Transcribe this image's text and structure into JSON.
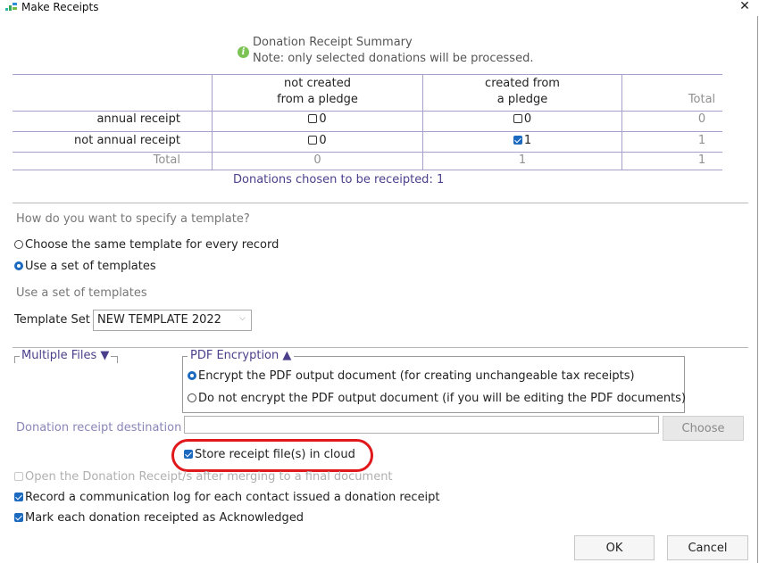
{
  "window": {
    "title": "Make Receipts",
    "close_glyph": "✕"
  },
  "summary": {
    "heading": "Donation Receipt Summary",
    "note": "Note: only selected donations will be processed.",
    "info_icon_glyph": "i"
  },
  "table": {
    "col1_line1": "not created",
    "col1_line2": "from a pledge",
    "col2_line1": "created from",
    "col2_line2": "a pledge",
    "col3": "Total",
    "rows": [
      {
        "label": "annual receipt",
        "c1": "0",
        "c1_checked": false,
        "c2": "0",
        "c2_checked": false,
        "total": "0"
      },
      {
        "label": "not annual receipt",
        "c1": "0",
        "c1_checked": false,
        "c2": "1",
        "c2_checked": true,
        "total": "1"
      }
    ],
    "total_row": {
      "label": "Total",
      "c1": "0",
      "c2": "1",
      "total": "1"
    },
    "chosen_text": "Donations chosen to be receipted: 1"
  },
  "template": {
    "question": "How do you want to specify a template?",
    "option_same": "Choose the same template for every record",
    "option_set": "Use a set of templates",
    "selected": "set",
    "subheading": "Use a set of templates",
    "set_label": "Template Set",
    "set_value": "NEW TEMPLATE 2022"
  },
  "multiple_files": {
    "label": "Multiple Files ▼"
  },
  "pdf": {
    "label": "PDF Encryption ▲",
    "encrypt": "Encrypt the PDF output document (for creating unchangeable tax receipts)",
    "no_encrypt": "Do not encrypt the PDF output document (if you will be editing the PDF documents)",
    "selected": "encrypt"
  },
  "destination": {
    "label": "Donation receipt destination",
    "value": "",
    "choose_label": "Choose"
  },
  "options": {
    "store_cloud": "Store receipt file(s) in cloud",
    "open_receipts": "Open the Donation Receipt/s after merging to a final document",
    "record_log": "Record a communication log for each contact issued a donation receipt",
    "mark_ack": "Mark each donation receipted as Acknowledged"
  },
  "buttons": {
    "ok": "OK",
    "cancel": "Cancel"
  },
  "colors": {
    "accent": "#1b6ac0",
    "highlight": "#e0171b",
    "grid": "#a7a0c8",
    "purple_text": "#4a3f8a"
  }
}
